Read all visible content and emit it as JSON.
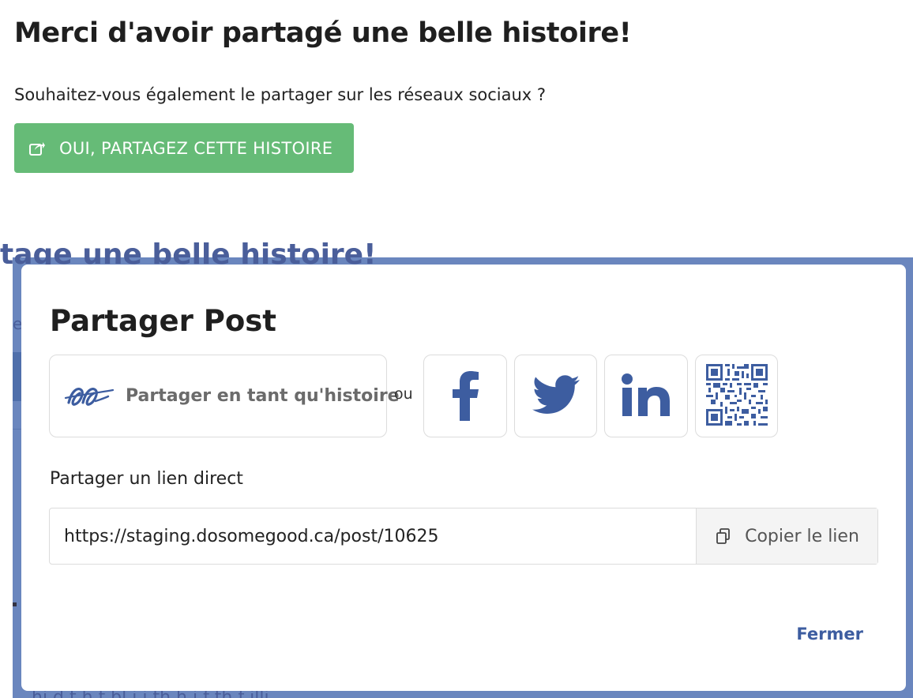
{
  "page": {
    "title": "Merci d'avoir partagé une belle histoire!",
    "question": "Souhaitez-vous également le partager sur les réseaux sociaux ?",
    "share_button": {
      "label": "OUI, PARTAGEZ CETTE HISTOIRE",
      "color": "#66bb77"
    }
  },
  "modal": {
    "title": "Partager Post",
    "story_share": {
      "label": "Partager en tant qu'histoire"
    },
    "or_label": "ou",
    "social": [
      "facebook-icon",
      "twitter-icon",
      "linkedin-icon",
      "qr-code-icon"
    ],
    "direct_link": {
      "label": "Partager un lien direct",
      "url": "https://staging.dosomegood.ca/post/10625",
      "copy_label": "Copier le lien"
    },
    "close_label": "Fermer"
  },
  "colors": {
    "brand_blue": "#3d5da0",
    "overlay": "#6a86be",
    "success_green": "#66bb77"
  }
}
